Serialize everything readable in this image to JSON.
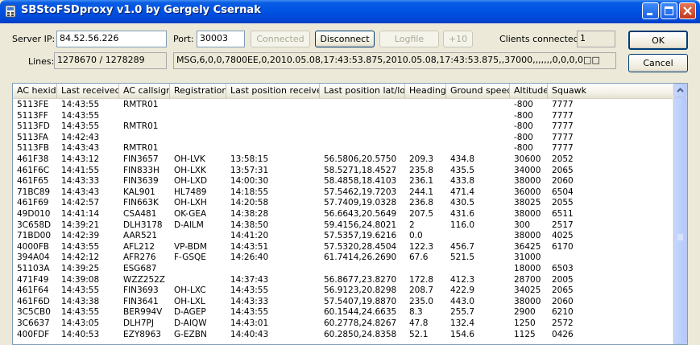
{
  "window": {
    "title": "SBStoFSDproxy v1.0 by Gergely Csernak"
  },
  "server": {
    "ip_label": "Server IP:",
    "ip_value": "84.52.56.226",
    "port_label": "Port:",
    "port_value": "30003"
  },
  "buttons": {
    "connected": "Connected",
    "disconnect": "Disconnect",
    "logfile": "Logfile",
    "plus10": "+10",
    "ok": "OK",
    "cancel": "Cancel"
  },
  "clients": {
    "label": "Clients connected:",
    "value": "1"
  },
  "lines": {
    "label": "Lines:",
    "value": "1278670 / 1278289"
  },
  "message": "MSG,6,0,0,7800EE,0,2010.05.08,17:43:53.875,2010.05.08,17:43:53.875,,37000,,,,,,,0,0,0,0□□",
  "columns": [
    "AC hexid",
    "Last received",
    "AC callsign",
    "Registration",
    "Last position received",
    "Last position lat/lon",
    "Heading",
    "Ground speed",
    "Altitude",
    "Squawk"
  ],
  "rows": [
    [
      "5113FE",
      "14:43:55",
      "RMTR01",
      "",
      "",
      "",
      "",
      "",
      "-800",
      "7777"
    ],
    [
      "5113FF",
      "14:43:55",
      "",
      "",
      "",
      "",
      "",
      "",
      "-800",
      "7777"
    ],
    [
      "5113FD",
      "14:43:55",
      "RMTR01",
      "",
      "",
      "",
      "",
      "",
      "-800",
      "7777"
    ],
    [
      "5113FA",
      "14:42:43",
      "",
      "",
      "",
      "",
      "",
      "",
      "-800",
      "7777"
    ],
    [
      "5113FB",
      "14:43:43",
      "RMTR01",
      "",
      "",
      "",
      "",
      "",
      "-800",
      "7777"
    ],
    [
      "461F38",
      "14:43:12",
      "FIN3657",
      "OH-LVK",
      "13:58:15",
      "56.5806,20.5750",
      "209.3",
      "434.8",
      "30600",
      "2052"
    ],
    [
      "461F6C",
      "14:41:55",
      "FIN833H",
      "OH-LXK",
      "13:57:31",
      "58.5271,18.4527",
      "235.8",
      "435.5",
      "34000",
      "2065"
    ],
    [
      "461F65",
      "14:43:33",
      "FIN3639",
      "OH-LXD",
      "14:00:30",
      "58.4858,18.4103",
      "236.1",
      "433.8",
      "38000",
      "2060"
    ],
    [
      "71BC89",
      "14:43:43",
      "KAL901",
      "HL7489",
      "14:18:55",
      "57.5462,19.7203",
      "244.1",
      "471.4",
      "36000",
      "6504"
    ],
    [
      "461F69",
      "14:42:57",
      "FIN663K",
      "OH-LXH",
      "14:20:58",
      "57.7409,19.0328",
      "236.8",
      "430.5",
      "38025",
      "2055"
    ],
    [
      "49D010",
      "14:41:14",
      "CSA481",
      "OK-GEA",
      "14:38:28",
      "56.6643,20.5649",
      "207.5",
      "431.6",
      "38000",
      "6511"
    ],
    [
      "3C658D",
      "14:39:21",
      "DLH3178",
      "D-AILM",
      "14:38:50",
      "59.4156,24.8021",
      "2",
      "116.0",
      "300",
      "2517"
    ],
    [
      "71BD00",
      "14:42:39",
      "AAR521",
      "",
      "14:41:20",
      "57.5357,19.6216",
      "0.0",
      "",
      "38000",
      "4025"
    ],
    [
      "4000FB",
      "14:43:55",
      "AFL212",
      "VP-BDM",
      "14:43:51",
      "57.5320,28.4504",
      "122.3",
      "456.7",
      "36425",
      "6170"
    ],
    [
      "394A04",
      "14:42:12",
      "AFR276",
      "F-GSQE",
      "14:26:40",
      "61.7414,26.2690",
      "67.6",
      "521.5",
      "31000",
      ""
    ],
    [
      "51103A",
      "14:39:25",
      "ESG687",
      "",
      "",
      "",
      "",
      "",
      "18000",
      "6503"
    ],
    [
      "471F49",
      "14:39:08",
      "WZZ252Z",
      "",
      "14:37:43",
      "56.8677,23.8270",
      "172.8",
      "412.3",
      "28700",
      "2005"
    ],
    [
      "461F64",
      "14:43:55",
      "FIN3693",
      "OH-LXC",
      "14:43:55",
      "56.9123,20.8298",
      "208.7",
      "422.9",
      "34025",
      "2065"
    ],
    [
      "461F6D",
      "14:43:38",
      "FIN3641",
      "OH-LXL",
      "14:43:33",
      "57.5407,19.8870",
      "235.0",
      "443.0",
      "38000",
      "2060"
    ],
    [
      "3C5CB0",
      "14:43:55",
      "BER994V",
      "D-AGEP",
      "14:43:55",
      "60.1544,24.6635",
      "8.3",
      "255.7",
      "2900",
      "6210"
    ],
    [
      "3C6637",
      "14:43:05",
      "DLH7PJ",
      "D-AIQW",
      "14:43:01",
      "60.2778,24.8267",
      "47.8",
      "132.4",
      "1250",
      "2572"
    ],
    [
      "400FDF",
      "14:40:53",
      "EZY8963",
      "G-EZBN",
      "14:40:43",
      "60.2850,24.8358",
      "52.1",
      "154.6",
      "1125",
      "0426"
    ]
  ]
}
